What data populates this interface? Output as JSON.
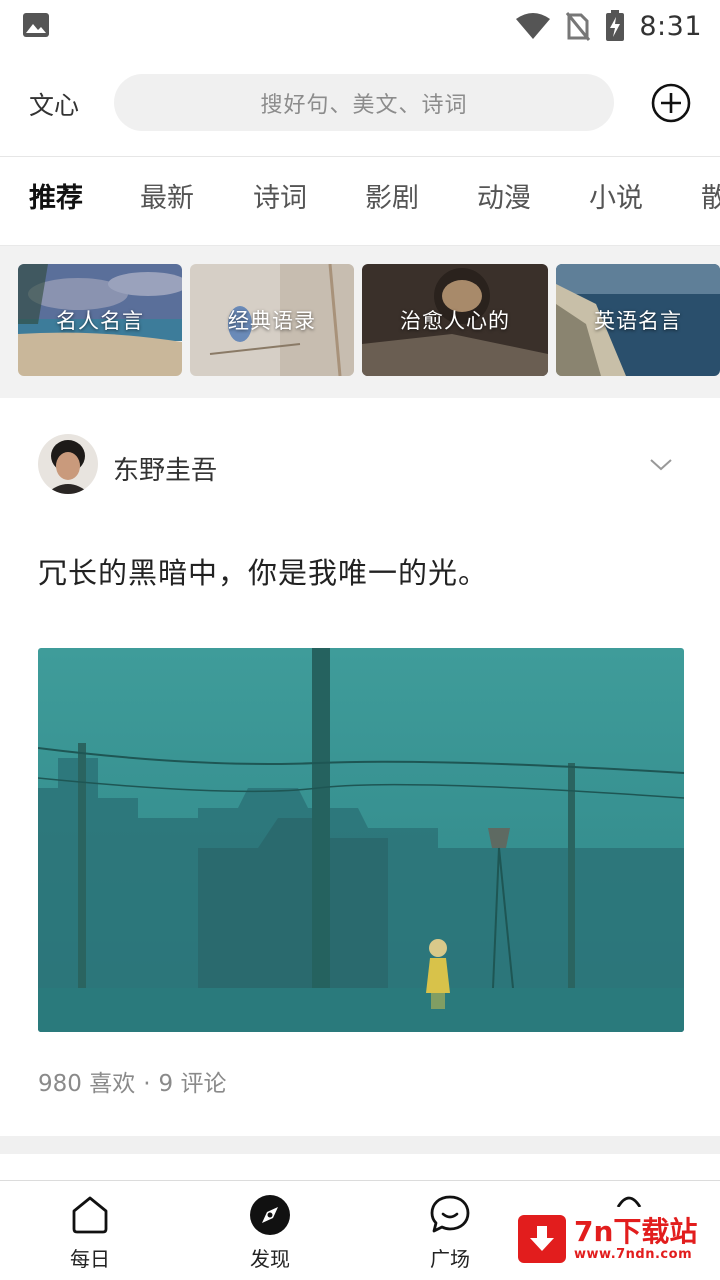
{
  "status_bar": {
    "time": "8:31",
    "icons": [
      "gallery-icon",
      "wifi-icon",
      "no-sim-icon",
      "battery-charging-icon"
    ]
  },
  "header": {
    "app_name": "文心",
    "search_placeholder": "搜好句、美文、诗词",
    "add_icon": "plus-circle-icon"
  },
  "tabs": [
    "推荐",
    "最新",
    "诗词",
    "影剧",
    "动漫",
    "小说",
    "散"
  ],
  "active_tab": "推荐",
  "topics": [
    {
      "label": "名人名言"
    },
    {
      "label": "经典语录"
    },
    {
      "label": "治愈人心的"
    },
    {
      "label": "英语名言"
    }
  ],
  "post": {
    "author": "东野圭吾",
    "quote": "冗长的黑暗中，你是我唯一的光。",
    "likes": "980 喜欢",
    "separator": "·",
    "comments": "9 评论"
  },
  "bottom_nav": [
    {
      "label": "每日",
      "icon": "home-icon"
    },
    {
      "label": "发现",
      "icon": "compass-icon"
    },
    {
      "label": "广场",
      "icon": "chat-bubble-icon"
    }
  ],
  "watermark": {
    "title": "7n下载站",
    "url": "www.7ndn.com"
  },
  "colors": {
    "accent_red": "#e21d1d",
    "search_bg": "#f0f0f0",
    "image_teal": "#3a9a98"
  }
}
